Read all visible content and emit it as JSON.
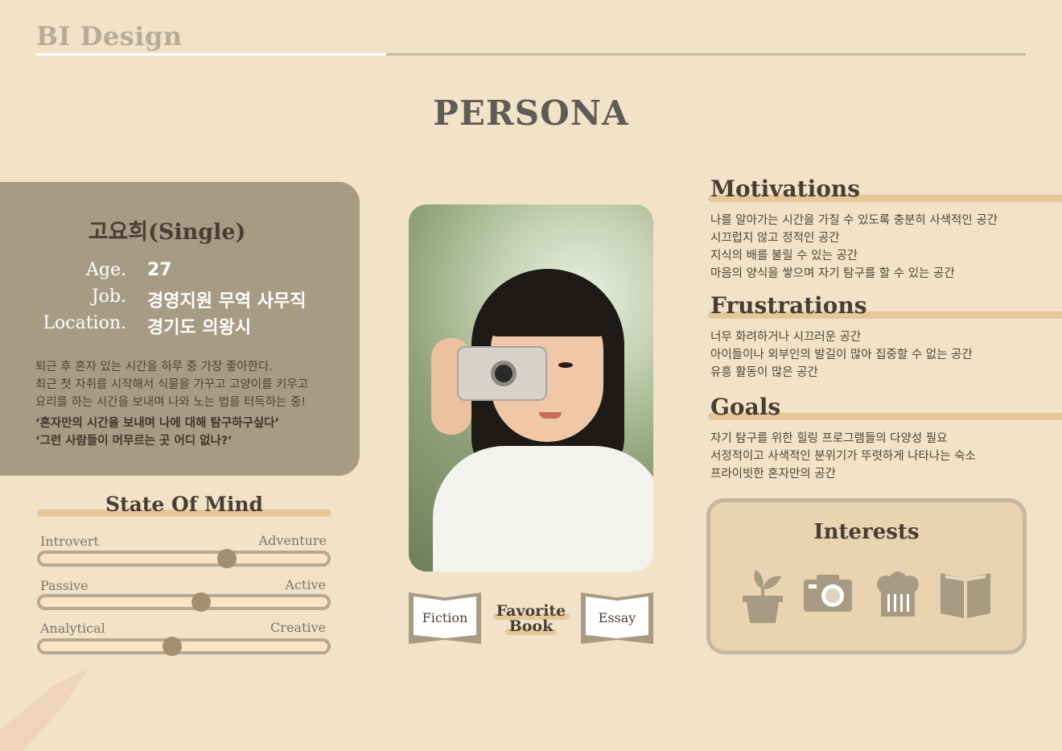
{
  "header": {
    "brand": "BI Design",
    "title": "PERSONA"
  },
  "profile": {
    "name": "고요희(Single)",
    "facts": [
      {
        "label": "Age.",
        "value": "27"
      },
      {
        "label": "Job.",
        "value": "경영지원 무역 사무직"
      },
      {
        "label": "Location.",
        "value": "경기도 의왕시"
      }
    ],
    "description": [
      "퇴근 후 혼자 있는 시간을 하루 중 가장 좋아한다.",
      "최근 첫 자취를 시작해서 식물을 가꾸고 고양이를 키우고",
      "요리를 하는 시간을 보내며 나와 노는 법을 터득하는 중!"
    ],
    "quotes": [
      "‘혼자만의 시간을 보내며 나에 대해 탐구하구싶다’",
      "‘그런 사람들이 머무르는 곳 어디 없나?’"
    ]
  },
  "state_of_mind": {
    "title": "State Of Mind",
    "sliders": [
      {
        "left": "Introvert",
        "right": "Adventure",
        "value": 0.65
      },
      {
        "left": "Passive",
        "right": "Active",
        "value": 0.56
      },
      {
        "left": "Analytical",
        "right": "Creative",
        "value": 0.46
      }
    ]
  },
  "books": {
    "left": "Fiction",
    "center_line1": "Favorite",
    "center_line2": "Book",
    "right": "Essay"
  },
  "motivations": {
    "title": "Motivations",
    "items": [
      "나를 알아가는 시간을 가질 수 있도록 충분히 사색적인 공간",
      "시끄럽지 않고 정적인 공간",
      "지식의 배를 불릴 수 있는 공간",
      "마음의 양식을 쌓으며 자기 탐구를 할 수 있는 공간"
    ]
  },
  "frustrations": {
    "title": "Frustrations",
    "items": [
      "너무 화려하거나 시끄러운 공간",
      "아이들이나 외부인의 발길이 많아 집중할 수 없는 공간",
      "유흥 활동이 많은 공간"
    ]
  },
  "goals": {
    "title": "Goals",
    "items": [
      "자기 탐구를 위한 힐링 프로그램들의 다양성 필요",
      "서정적이고 사색적인 분위기가 뚜렷하게 나타나는 숙소",
      "프라이빗한 혼자만의 공간"
    ]
  },
  "interests": {
    "title": "Interests",
    "icons": [
      "plant-icon",
      "camera-icon",
      "chef-hat-icon",
      "book-icon"
    ],
    "icon_color": "#a89b83"
  },
  "colors": {
    "background": "#f2e3c8",
    "card": "#a89b83",
    "accent_bar": "#e5c79b",
    "slider_fill": "#fbe3c4"
  }
}
